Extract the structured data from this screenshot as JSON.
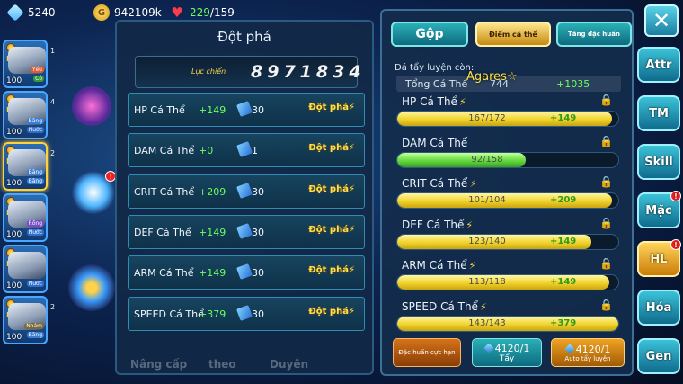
{
  "top_bar": {
    "gems": "5240",
    "gold": "942109k",
    "energy_current": "229",
    "energy_max": "/159"
  },
  "heroes": [
    {
      "level": "100",
      "tags": [
        "Yếu",
        "Cỏ"
      ],
      "tag_colors": [
        "#e25a2d",
        "#2f9a3a"
      ],
      "num": "1"
    },
    {
      "level": "100",
      "tags": [
        "Băng",
        "Nước"
      ],
      "tag_colors": [
        "#3a7fd6",
        "#2f6fd0"
      ],
      "num": "4"
    },
    {
      "level": "100",
      "tags": [
        "Băng",
        "Băng"
      ],
      "tag_colors": [
        "#3a7fd6",
        "#3a7fd6"
      ],
      "num": "2"
    },
    {
      "level": "100",
      "tags": [
        "Rồng",
        "Nước"
      ],
      "tag_colors": [
        "#7a4bc8",
        "#2f6fd0"
      ],
      "num": ""
    },
    {
      "level": "100",
      "tags": [
        "",
        "Nước"
      ],
      "tag_colors": [
        "#2f6fd0",
        "#2f6fd0"
      ],
      "num": ""
    },
    {
      "level": "100",
      "tags": [
        "Nhám",
        "Băng"
      ],
      "tag_colors": [
        "#7a6a3a",
        "#3a7fd6"
      ],
      "num": "2"
    }
  ],
  "breakthrough": {
    "title": "Đột phá",
    "power_label": "Lực chiến",
    "power_value": "8971834",
    "rows": [
      {
        "name": "HP Cá Thể",
        "bonus": "+149",
        "cost": "30",
        "button": "Đột phá"
      },
      {
        "name": "DAM Cá Thể",
        "bonus": "+0",
        "cost": "1",
        "button": "Đột phá"
      },
      {
        "name": "CRIT Cá Thể",
        "bonus": "+209",
        "cost": "30",
        "button": "Đột phá"
      },
      {
        "name": "DEF Cá Thể",
        "bonus": "+149",
        "cost": "30",
        "button": "Đột phá"
      },
      {
        "name": "ARM Cá Thể",
        "bonus": "+149",
        "cost": "30",
        "button": "Đột phá"
      },
      {
        "name": "SPEED Cá Thể",
        "bonus": "+379",
        "cost": "30",
        "button": "Đột phá"
      }
    ]
  },
  "ghost_tabs": [
    "Nâng cấp",
    "theo",
    "Duyên"
  ],
  "stats_panel": {
    "tabs": [
      "Gộp",
      "Điểm cá thể",
      "Tăng đặc huấn"
    ],
    "note": "Đá tẩy luyện còn:",
    "hero_name": "Agares☆",
    "total_label": "Tổng Cá Thể",
    "total_value": "744",
    "total_bonus": "+1035",
    "stats": [
      {
        "name": "HP Cá Thể",
        "value": "167/172",
        "bonus": "+149",
        "fill": 0.971,
        "color": "yellow",
        "bolt": true
      },
      {
        "name": "DAM Cá Thể",
        "value": "92/158",
        "bonus": "",
        "fill": 0.582,
        "color": "green",
        "bolt": false
      },
      {
        "name": "CRIT Cá Thể",
        "value": "101/104",
        "bonus": "+209",
        "fill": 0.971,
        "color": "yellow",
        "bolt": true
      },
      {
        "name": "DEF Cá Thể",
        "value": "123/140",
        "bonus": "+149",
        "fill": 0.879,
        "color": "yellow",
        "bolt": true
      },
      {
        "name": "ARM Cá Thể",
        "value": "113/118",
        "bonus": "+149",
        "fill": 0.958,
        "color": "yellow",
        "bolt": true
      },
      {
        "name": "SPEED Cá Thể",
        "value": "143/143",
        "bonus": "+379",
        "fill": 1.0,
        "color": "yellow",
        "bolt": true
      }
    ],
    "buttons": {
      "special_train": "Đặc huấn cực hạn",
      "wash_count": "4120/1",
      "wash_label": "Tẩy",
      "auto_count": "4120/1",
      "auto_label": "Auto tẩy luyện"
    }
  },
  "side_menu": [
    {
      "label": "Attr",
      "badge": false,
      "active": false
    },
    {
      "label": "TM",
      "badge": false,
      "active": false
    },
    {
      "label": "Skill",
      "badge": false,
      "active": false
    },
    {
      "label": "Mặc",
      "badge": true,
      "active": false
    },
    {
      "label": "HL",
      "badge": true,
      "active": true
    },
    {
      "label": "Hóa",
      "badge": false,
      "active": false
    },
    {
      "label": "Gen",
      "badge": false,
      "active": false
    }
  ],
  "close_label": "✕",
  "lightning": "⚡",
  "lock": "🔒",
  "badge_mark": "!"
}
